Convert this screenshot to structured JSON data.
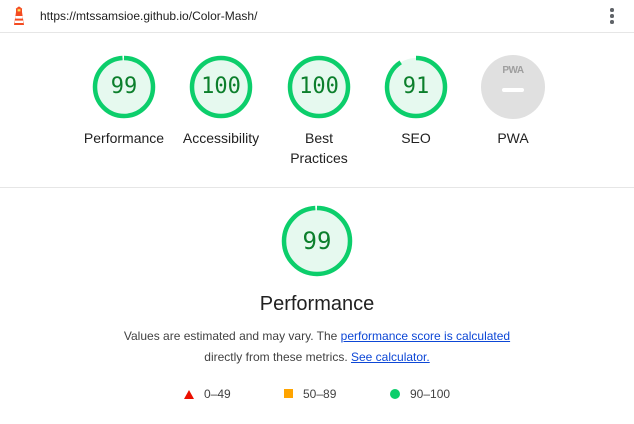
{
  "header": {
    "url": "https://mtssamsioe.github.io/Color-Mash/"
  },
  "gauges": [
    {
      "score": "99",
      "label": "Performance",
      "fraction": 0.99
    },
    {
      "score": "100",
      "label": "Accessibility",
      "fraction": 1.0
    },
    {
      "score": "100",
      "label": "Best Practices",
      "fraction": 1.0
    },
    {
      "score": "91",
      "label": "SEO",
      "fraction": 0.91
    },
    {
      "score": "",
      "label": "PWA",
      "badge_text": "PWA"
    }
  ],
  "detail": {
    "score": "99",
    "fraction": 0.99,
    "title": "Performance",
    "desc_prefix": "Values are estimated and may vary. The ",
    "desc_link1": "performance score is calculated",
    "desc_middle": "directly from these metrics.",
    "desc_link2": "See calculator."
  },
  "legend": [
    {
      "range": "0–49",
      "color": "#eb0f00",
      "shape": "triangle"
    },
    {
      "range": "50–89",
      "color": "#ffa400",
      "shape": "square"
    },
    {
      "range": "90–100",
      "color": "#0cce6b",
      "shape": "circle"
    }
  ],
  "colors": {
    "pass_ring": "#0cce6b",
    "pass_fill": "#e6f9ef",
    "pass_text": "#0c7f2c",
    "link": "#0d47d6"
  }
}
